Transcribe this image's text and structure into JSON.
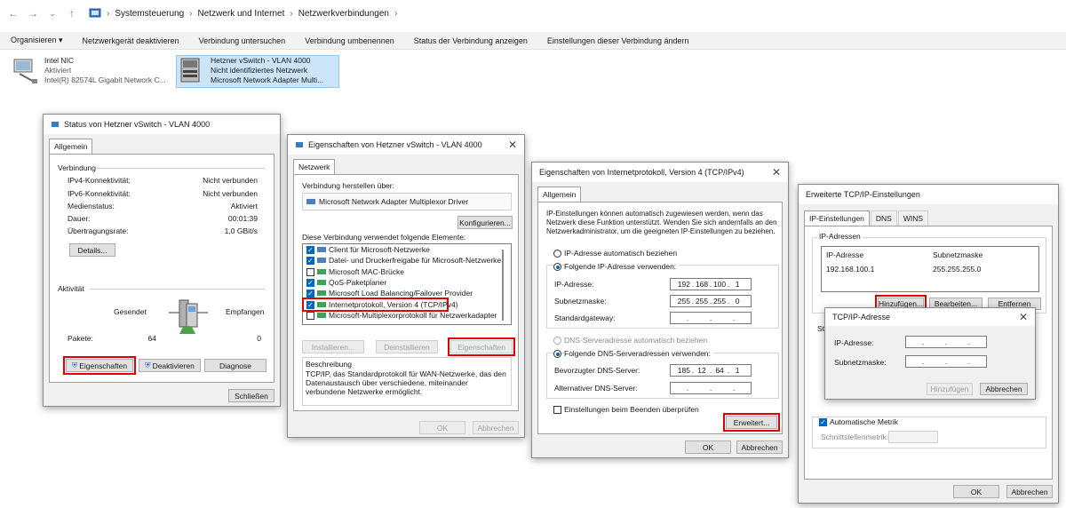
{
  "explorer": {
    "breadcrumb": [
      "Systemsteuerung",
      "Netzwerk und Internet",
      "Netzwerkverbindungen"
    ],
    "commands": [
      "Organisieren ▾",
      "Netzwerkgerät deaktivieren",
      "Verbindung untersuchen",
      "Verbindung umbenennen",
      "Status der Verbindung anzeigen",
      "Einstellungen dieser Verbindung ändern"
    ],
    "adapters": [
      {
        "name": "Intel NIC",
        "status": "Aktiviert",
        "device": "Intel(R) 82574L Gigabit Network C..."
      },
      {
        "name": "Hetzner vSwitch - VLAN 4000",
        "status": "Nicht identifiziertes Netzwerk",
        "device": "Microsoft Network Adapter Multi..."
      }
    ]
  },
  "status_dialog": {
    "title": "Status von Hetzner vSwitch - VLAN 4000",
    "tab": "Allgemein",
    "connection_header": "Verbindung",
    "rows": [
      {
        "label": "IPv4-Konnektivität:",
        "value": "Nicht verbunden"
      },
      {
        "label": "IPv6-Konnektivität:",
        "value": "Nicht verbunden"
      },
      {
        "label": "Medienstatus:",
        "value": "Aktiviert"
      },
      {
        "label": "Dauer:",
        "value": "00:01:39"
      },
      {
        "label": "Übertragungsrate:",
        "value": "1,0 GBit/s"
      }
    ],
    "details_btn": "Details...",
    "activity_header": "Aktivität",
    "sent": "Gesendet",
    "received": "Empfangen",
    "packets_label": "Pakete:",
    "packets_sent": "64",
    "packets_received": "0",
    "properties_btn": "Eigenschaften",
    "disable_btn": "Deaktivieren",
    "diagnose_btn": "Diagnose",
    "close_btn": "Schließen"
  },
  "props_dialog": {
    "title": "Eigenschaften von Hetzner vSwitch - VLAN 4000",
    "tab": "Netzwerk",
    "connect_using": "Verbindung herstellen über:",
    "adapter": "Microsoft Network Adapter Multiplexor Driver",
    "configure_btn": "Konfigurieren...",
    "items_label": "Diese Verbindung verwendet folgende Elemente:",
    "items": [
      {
        "label": "Client für Microsoft-Netzwerke",
        "checked": true
      },
      {
        "label": "Datei- und Druckerfreigabe für Microsoft-Netzwerke",
        "checked": true
      },
      {
        "label": "Microsoft MAC-Brücke",
        "checked": false
      },
      {
        "label": "QoS-Paketplaner",
        "checked": true
      },
      {
        "label": "Microsoft Load Balancing/Failover Provider",
        "checked": true
      },
      {
        "label": "Internetprotokoll, Version 4 (TCP/IPv4)",
        "checked": true
      },
      {
        "label": "Microsoft-Multiplexorprotokoll für Netzwerkadapter",
        "checked": false
      }
    ],
    "install_btn": "Installieren...",
    "uninstall_btn": "Deinstallieren",
    "properties_btn": "Eigenschaften",
    "description_header": "Beschreibung",
    "description": "TCP/IP, das Standardprotokoll für WAN-Netzwerke, das den Datenaustausch über verschiedene, miteinander verbundene Netzwerke ermöglicht.",
    "ok_btn": "OK",
    "cancel_btn": "Abbrechen"
  },
  "ipv4_dialog": {
    "title": "Eigenschaften von Internetprotokoll, Version 4 (TCP/IPv4)",
    "tab": "Allgemein",
    "intro": "IP-Einstellungen können automatisch zugewiesen werden, wenn das Netzwerk diese Funktion unterstützt. Wenden Sie sich andernfalls an den Netzwerkadministrator, um die geeigneten IP-Einstellungen zu beziehen.",
    "auto_ip": "IP-Adresse automatisch beziehen",
    "manual_ip": "Folgende IP-Adresse verwenden:",
    "ip_label": "IP-Adresse:",
    "ip_value": [
      "192",
      "168",
      "100",
      "1"
    ],
    "mask_label": "Subnetzmaske:",
    "mask_value": [
      "255",
      "255",
      "255",
      "0"
    ],
    "gateway_label": "Standardgateway:",
    "auto_dns": "DNS-Serveradresse automatisch beziehen",
    "manual_dns": "Folgende DNS-Serveradressen verwenden:",
    "pref_dns_label": "Bevorzugter DNS-Server:",
    "pref_dns_value": [
      "185",
      "12",
      "64",
      "1"
    ],
    "alt_dns_label": "Alternativer DNS-Server:",
    "validate": "Einstellungen beim Beenden überprüfen",
    "advanced_btn": "Erweitert...",
    "ok_btn": "OK",
    "cancel_btn": "Abbrechen"
  },
  "advanced_dialog": {
    "title": "Erweiterte TCP/IP-Einstellungen",
    "tabs": [
      "IP-Einstellungen",
      "DNS",
      "WINS"
    ],
    "ip_group": "IP-Adressen",
    "col_ip": "IP-Adresse",
    "col_mask": "Subnetzmaske",
    "row_ip": "192.168.100.1",
    "row_mask": "255.255.255.0",
    "add_btn": "Hinzufügen...",
    "edit_btn": "Bearbeiten...",
    "remove_btn": "Entfernen",
    "partial_label": "Sta",
    "auto_metric": "Automatische Metrik",
    "interface_metric": "Schnittstellenmetrik:",
    "ok_btn": "OK",
    "cancel_btn": "Abbrechen"
  },
  "tcpip_dialog": {
    "title": "TCP/IP-Adresse",
    "ip_label": "IP-Adresse:",
    "mask_label": "Subnetzmaske:",
    "add_btn": "Hinzufügen",
    "cancel_btn": "Abbrechen"
  }
}
